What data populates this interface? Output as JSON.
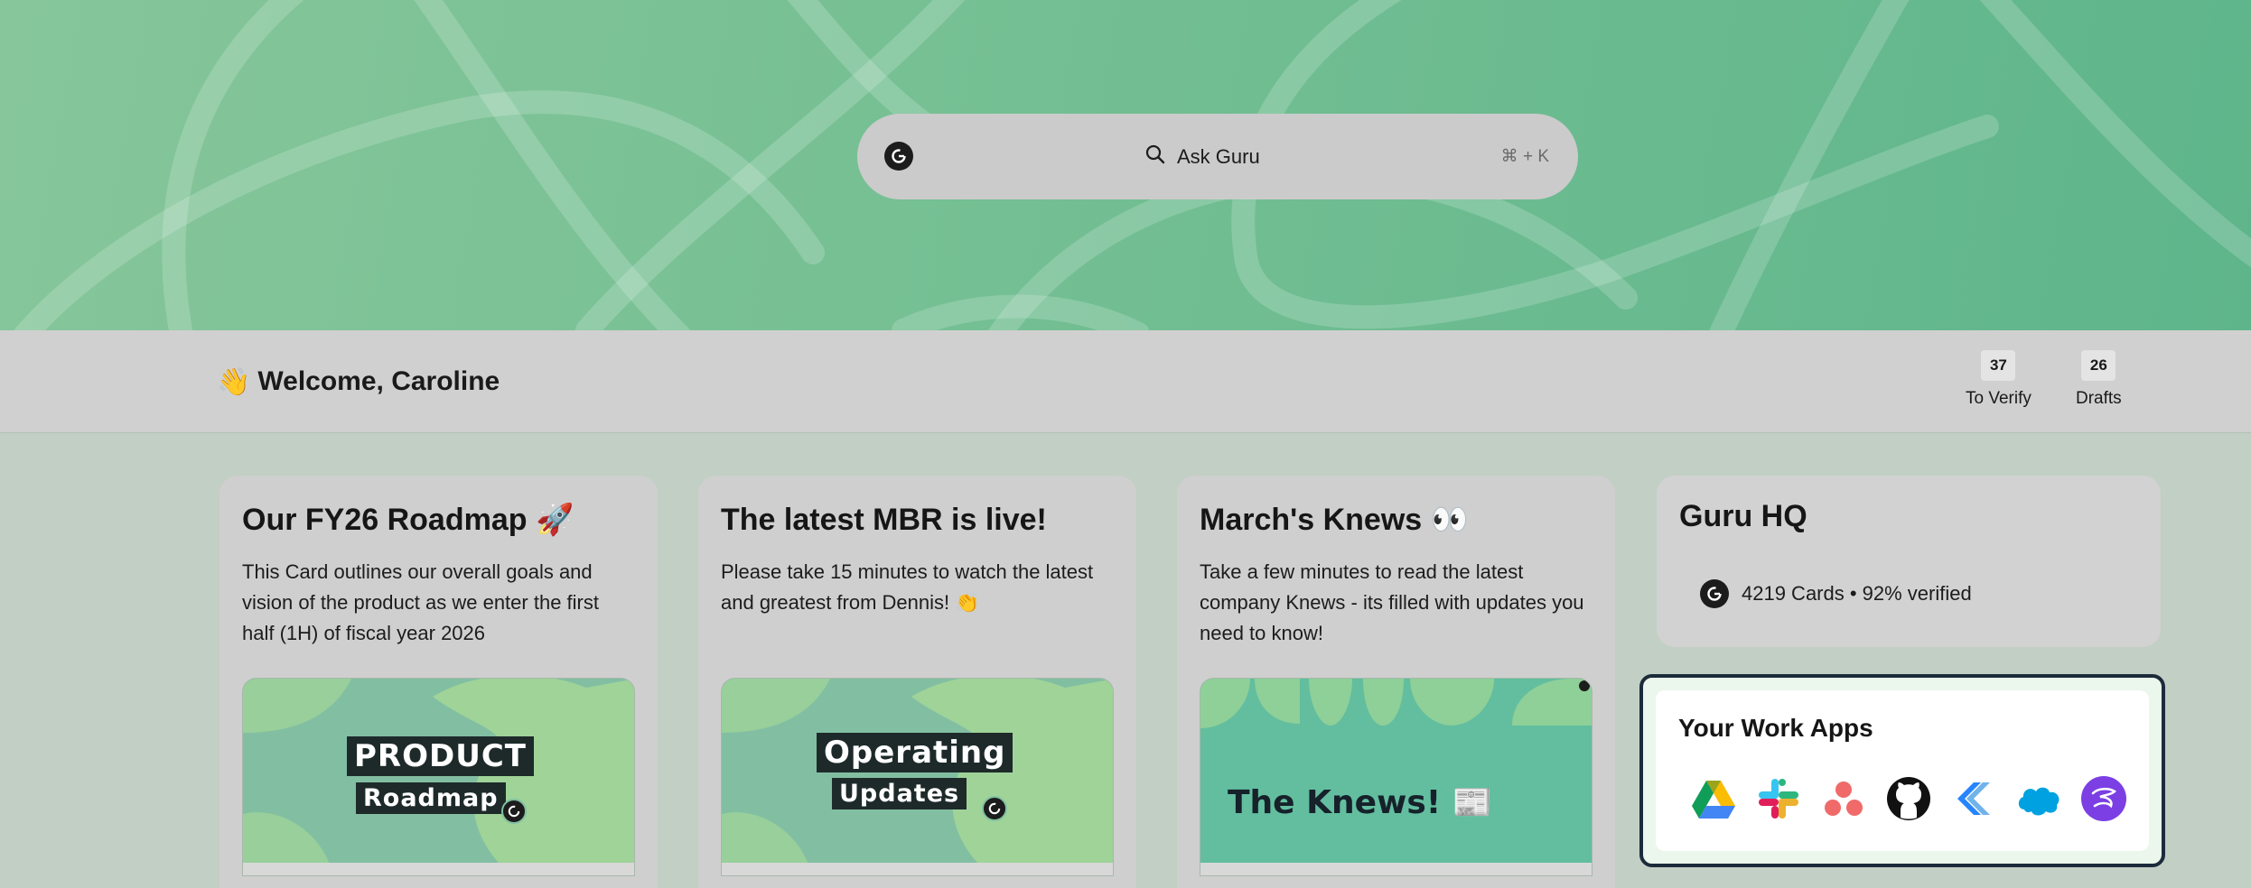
{
  "search": {
    "placeholder": "Ask Guru",
    "shortcut": "⌘ + K"
  },
  "welcome": {
    "emoji": "👋",
    "text": "Welcome, Caroline"
  },
  "stats": [
    {
      "value": "37",
      "label": "To Verify"
    },
    {
      "value": "26",
      "label": "Drafts"
    }
  ],
  "cards": [
    {
      "title": "Our FY26 Roadmap 🚀",
      "body": "This Card outlines our overall goals and vision of the product as we enter the first half (1H) of fiscal year 2026",
      "thumb_line1": "PRODUCT",
      "thumb_line2": "Roadmap"
    },
    {
      "title": "The latest MBR is live!",
      "body": "Please take 15 minutes to watch the latest and greatest from Dennis! 👏",
      "thumb_line1": "Operating",
      "thumb_line2": "Updates"
    },
    {
      "title": "March's Knews 👀",
      "body": "Take a few minutes to read the latest company Knews - its filled with updates you need to know!",
      "thumb_line1": "The Knews! 📰"
    }
  ],
  "hq": {
    "title": "Guru HQ",
    "stats_text": "4219 Cards • 92% verified"
  },
  "work_apps": {
    "title": "Your Work Apps",
    "apps": [
      "google-drive-icon",
      "slack-icon",
      "asana-icon",
      "github-icon",
      "jira-icon",
      "salesforce-icon",
      "app-icon"
    ]
  },
  "colors": {
    "hero_green": "#74bf93",
    "thumb_green": "#82c09a",
    "thumb_knews": "#62be9f",
    "apps_border": "#1c2b3b"
  }
}
